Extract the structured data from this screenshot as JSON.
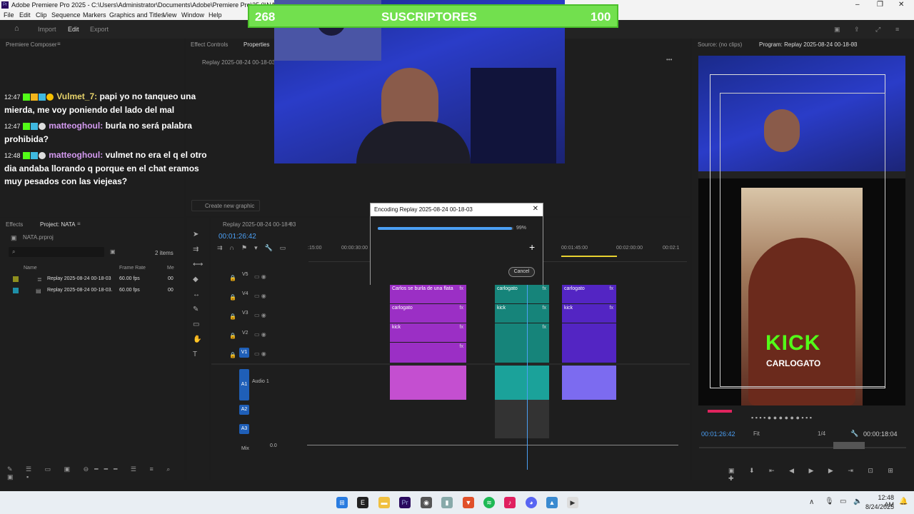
{
  "window": {
    "title": "Adobe Premiere Pro 2025 - C:\\Users\\Administrator\\Documents\\Adobe\\Premiere Pro\\25.0\\NATA",
    "app_badge": "Pr"
  },
  "menu": [
    "File",
    "Edit",
    "Clip",
    "Sequence",
    "Markers",
    "Graphics and Titles",
    "View",
    "Window",
    "Help"
  ],
  "workspace_tabs": [
    "Import",
    "Edit",
    "Export"
  ],
  "overlay": {
    "subs_left": "268",
    "subs_label": "SUSCRIPTORES",
    "subs_right": "100",
    "brand_color": "#72e04e"
  },
  "chat": [
    {
      "time": "12:47",
      "user": "Vulmet_7:",
      "message": "papi yo no tanqueo una mierda, me voy poniendo del lado del mal"
    },
    {
      "time": "12:47",
      "user": "matteoghoul:",
      "message": "burla no será palabra prohibida?"
    },
    {
      "time": "12:48",
      "user": "matteoghoul:",
      "message": "vulmet no era el q el otro dia andaba llorando q porque en el chat eramos muy pesados con las viejeas?"
    }
  ],
  "panels": {
    "composer": "Premiere Composer",
    "effect_controls": "Effect Controls",
    "properties": "Properties",
    "properties_clip": "Replay 2025-08-24 00-18-03",
    "create_graphic": "Create new graphic",
    "source": "Source: (no clips)",
    "program": "Program: Replay 2025-08-24 00-18-03"
  },
  "project": {
    "tab_effects": "Effects",
    "tab_project": "Project: NATA",
    "file": "NATA.prproj",
    "count": "2 items",
    "columns": [
      "Name",
      "Frame Rate",
      "Me"
    ],
    "items": [
      {
        "name": "Replay 2025-08-24 00-18-03",
        "rate": "60.00 fps",
        "me": "00",
        "color": "#8f8f1e"
      },
      {
        "name": "Replay 2025-08-24 00-18-03.",
        "rate": "60.00 fps",
        "me": "00",
        "color": "#1e8fa8"
      }
    ]
  },
  "timeline": {
    "sequence": "Replay 2025-08-24 00-18-03",
    "timecode": "00:01:26:42",
    "ruler": [
      ":15:00",
      "00:00:30:00",
      "00:01:45:00",
      "00:02:00:00",
      "00:02:1"
    ],
    "video_tracks": [
      "V5",
      "V4",
      "V3",
      "V2",
      "V1"
    ],
    "audio_tracks": [
      "A1",
      "A2",
      "A3"
    ],
    "audio_name": "Audio 1",
    "mix_label": "Mix",
    "mix_value": "0.0",
    "clips": {
      "c1": [
        "Carlos se burla de una flata",
        "carlogato",
        "kick"
      ],
      "c2": [
        "carlogato",
        "kick"
      ],
      "c3": [
        "carlogato",
        "kick"
      ]
    }
  },
  "dialog": {
    "title": "Encoding Replay 2025-08-24 00-18-03",
    "percent_label": "99%",
    "progress": 0.99,
    "cancel": "Cancel"
  },
  "program_monitor": {
    "timecode": "00:01:26:42",
    "fit": "Fit",
    "quality": "1/4",
    "duration": "00:00:18:04",
    "overlay_big": "KICK",
    "overlay_small": "CARLOGATO"
  },
  "taskbar": {
    "time": "12:48 AM",
    "date": "8/24/2025"
  }
}
